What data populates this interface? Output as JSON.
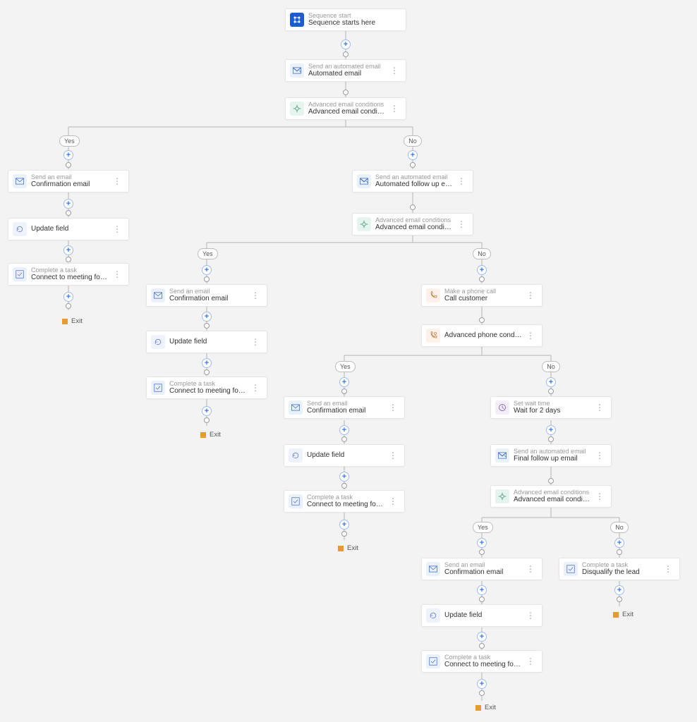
{
  "nodeTypes": {
    "start": "Sequence start",
    "autoEmail": "Send an automated email",
    "cond": "Advanced email conditions",
    "email": "Send an email",
    "update": "Update field",
    "task": "Complete a task",
    "phone": "Make a phone call",
    "phoneCond": "Advanced phone condition",
    "wait": "Set wait time"
  },
  "nodeTitles": {
    "start": "Sequence starts here",
    "autoEmail": "Automated email",
    "cond": "Advanced email conditions",
    "confirm": "Confirmation email",
    "update": "Update field",
    "followAuto": "Automated follow up email",
    "taskDemo": "Connect to meeting for product demo r...",
    "callCustomer": "Call customer",
    "phoneCond": "Advanced phone condition",
    "wait2": "Wait for 2 days",
    "finalFollow": "Final follow up email",
    "disqualify": "Disqualify the lead"
  },
  "labels": {
    "yes": "Yes",
    "no": "No",
    "exit": "Exit"
  }
}
